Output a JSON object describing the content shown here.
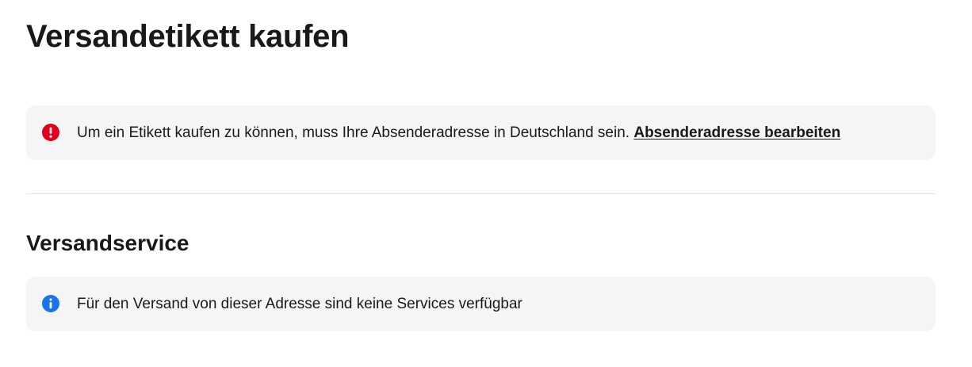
{
  "page": {
    "title": "Versandetikett kaufen"
  },
  "alert": {
    "icon": "error-alert-icon",
    "color": "#e0001b",
    "message": "Um ein Etikett kaufen zu können, muss Ihre Absenderadresse in Deutschland sein.",
    "link_label": "Absenderadresse bearbeiten"
  },
  "shipping_service": {
    "title": "Versandservice",
    "notice": {
      "icon": "info-icon",
      "color": "#1a73e8",
      "message": "Für den Versand von dieser Adresse sind keine Services verfügbar"
    }
  }
}
